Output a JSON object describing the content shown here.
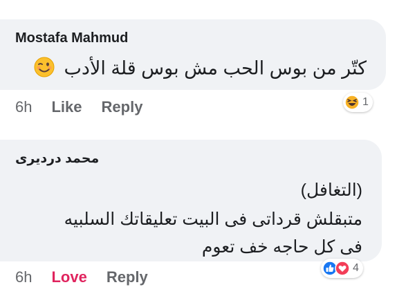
{
  "comments": [
    {
      "author": "Mostafa Mahmud",
      "lines": [
        "كتّر من بوس الحب مش بوس قلة الأدب"
      ],
      "time": "6h",
      "like_label": "Like",
      "reply_label": "Reply",
      "reaction_count": "1",
      "reaction_icons": [
        "haha-icon"
      ],
      "emoji": "wink-emoji"
    },
    {
      "author": "محمد درديرى",
      "lines": [
        "(التغافل)",
        "متبقلش قرداتى فى البيت تعليقاتك السلبيه",
        "فى كل حاجه خف تعوم"
      ],
      "time": "6h",
      "like_label": "Love",
      "reply_label": "Reply",
      "reaction_count": "4",
      "reaction_icons": [
        "like-icon",
        "love-icon"
      ]
    }
  ],
  "colors": {
    "bubble": "#f0f2f5",
    "text": "#1c1e21",
    "meta": "#65676b",
    "love": "#e0245e",
    "like_blue": "#1877f2",
    "haha_yellow": "#f7b125"
  }
}
